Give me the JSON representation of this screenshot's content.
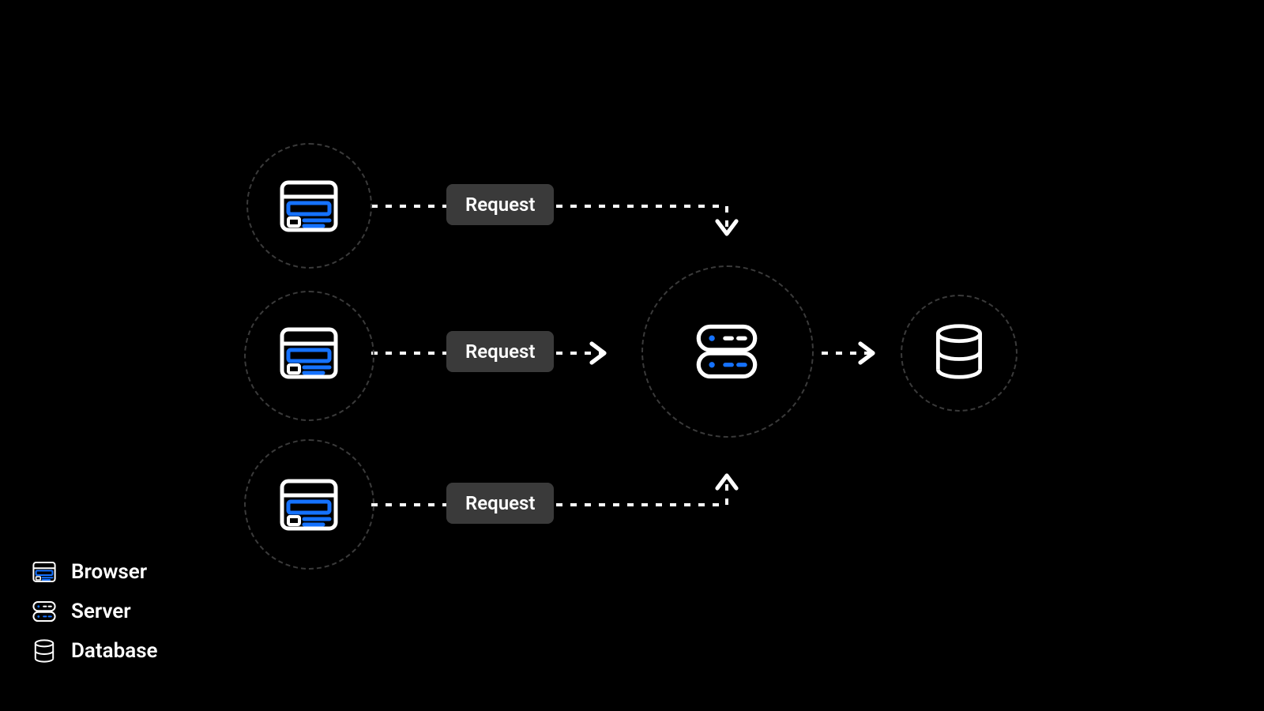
{
  "labels": {
    "request1": "Request",
    "request2": "Request",
    "request3": "Request"
  },
  "legend": {
    "browser": "Browser",
    "server": "Server",
    "database": "Database"
  }
}
